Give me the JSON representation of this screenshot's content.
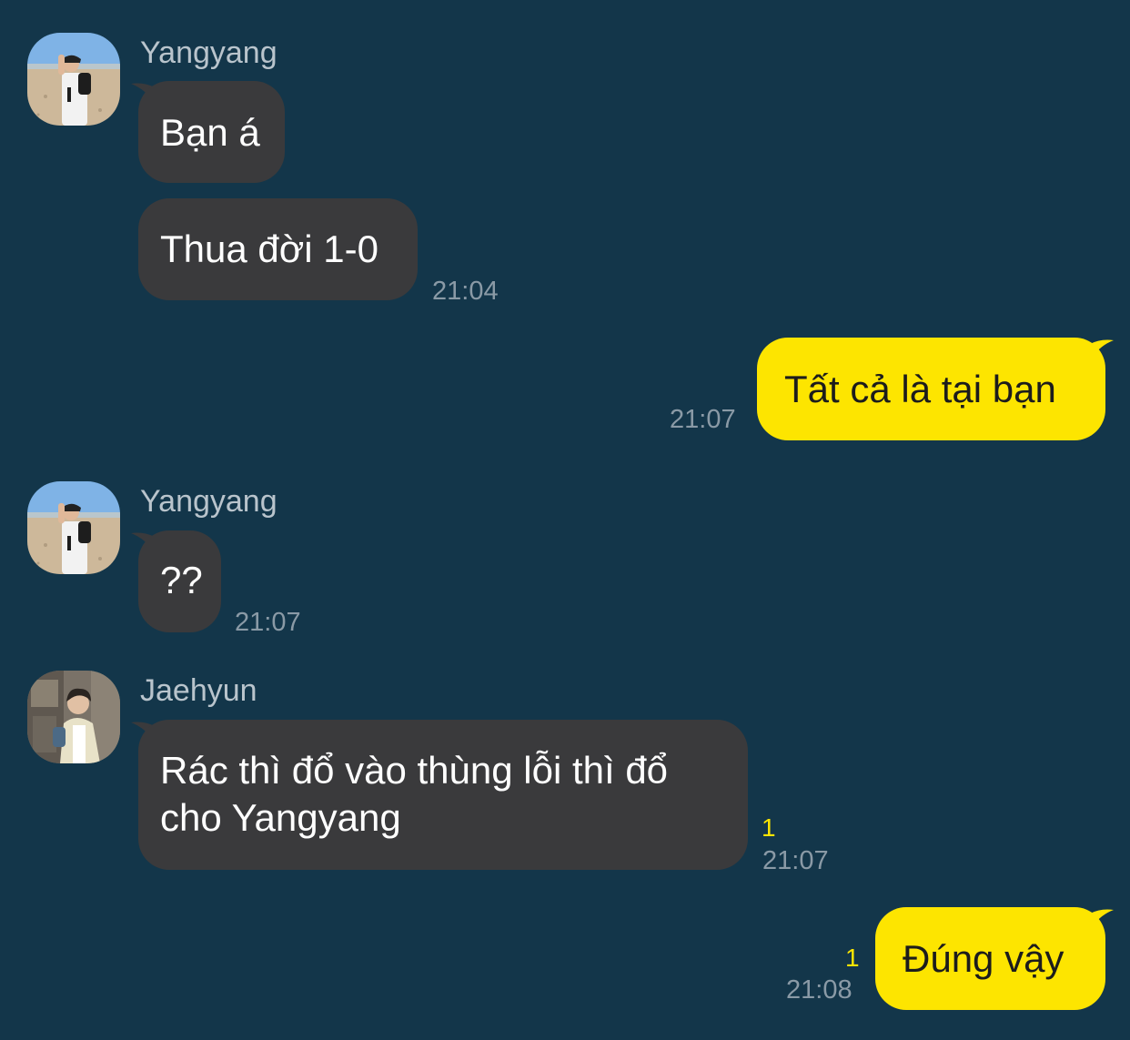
{
  "colors": {
    "background": "#13364a",
    "incoming_bubble": "#3a3a3c",
    "outgoing_bubble": "#fde500",
    "unread_indicator": "#fde500",
    "timestamp": "#8a9aa6",
    "sender_name": "#b9c4cc"
  },
  "messages": [
    {
      "sender": "Yangyang",
      "avatar": "yangyang-avatar-photo",
      "text": "Bạn á"
    },
    {
      "text": "Thua đời 1-0",
      "time": "21:04"
    },
    {
      "direction": "outgoing",
      "text": "Tất cả là tại bạn",
      "time": "21:07"
    },
    {
      "sender": "Yangyang",
      "avatar": "yangyang-avatar-photo",
      "text": "??",
      "time": "21:07"
    },
    {
      "sender": "Jaehyun",
      "avatar": "jaehyun-avatar-photo",
      "text_line1": "Rác thì đổ vào thùng lỗi thì đổ",
      "text_line2": "cho Yangyang",
      "unread": "1",
      "time": "21:07"
    },
    {
      "direction": "outgoing",
      "text": "Đúng vậy",
      "unread": "1",
      "time": "21:08"
    }
  ]
}
